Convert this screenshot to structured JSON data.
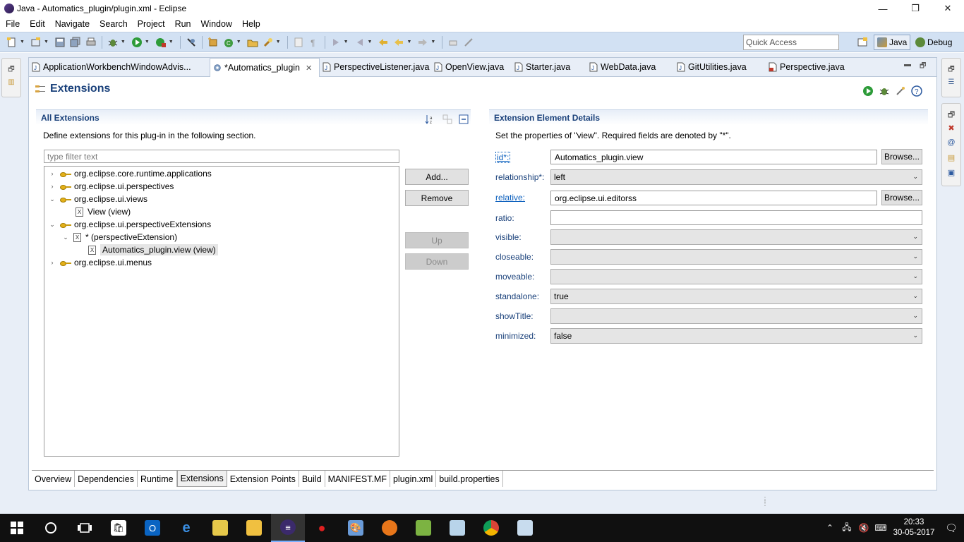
{
  "window": {
    "title": "Java - Automatics_plugin/plugin.xml - Eclipse",
    "minimize": "—",
    "restore": "❐",
    "close": "✕"
  },
  "menu": [
    "File",
    "Edit",
    "Navigate",
    "Search",
    "Project",
    "Run",
    "Window",
    "Help"
  ],
  "toolbar": {
    "quick_access_placeholder": "Quick Access",
    "perspectives": [
      "Java",
      "Debug"
    ]
  },
  "editor_tabs": [
    {
      "label": "ApplicationWorkbenchWindowAdvis...",
      "icon": "java-file-icon",
      "active": false
    },
    {
      "label": "*Automatics_plugin",
      "icon": "plugin-icon",
      "active": true,
      "close": "✕"
    },
    {
      "label": "PerspectiveListener.java",
      "icon": "java-file-icon",
      "active": false
    },
    {
      "label": "OpenView.java",
      "icon": "java-file-icon",
      "active": false
    },
    {
      "label": "Starter.java",
      "icon": "java-file-icon",
      "active": false
    },
    {
      "label": "WebData.java",
      "icon": "java-file-icon",
      "active": false
    },
    {
      "label": "GitUtilities.java",
      "icon": "java-file-icon",
      "active": false
    },
    {
      "label": "Perspective.java",
      "icon": "java-file-icon",
      "active": false
    }
  ],
  "form": {
    "title": "Extensions"
  },
  "all_extensions": {
    "title": "All Extensions",
    "description": "Define extensions for this plug-in in the following section.",
    "filter_placeholder": "type filter text",
    "tree": [
      {
        "label": "org.eclipse.core.runtime.applications",
        "level": 0,
        "type": "extension",
        "expanded": false
      },
      {
        "label": "org.eclipse.ui.perspectives",
        "level": 0,
        "type": "extension",
        "expanded": false
      },
      {
        "label": "org.eclipse.ui.views",
        "level": 0,
        "type": "extension",
        "expanded": true
      },
      {
        "label": "View (view)",
        "level": 1,
        "type": "element",
        "expanded": null
      },
      {
        "label": "org.eclipse.ui.perspectiveExtensions",
        "level": 0,
        "type": "extension",
        "expanded": true
      },
      {
        "label": "* (perspectiveExtension)",
        "level": 1,
        "type": "element",
        "expanded": true
      },
      {
        "label": "Automatics_plugin.view (view)",
        "level": 2,
        "type": "element",
        "expanded": null,
        "selected": true
      },
      {
        "label": "org.eclipse.ui.menus",
        "level": 0,
        "type": "extension",
        "expanded": false
      }
    ],
    "buttons": {
      "add": "Add...",
      "remove": "Remove",
      "up": "Up",
      "down": "Down"
    }
  },
  "details": {
    "title": "Extension Element Details",
    "description": "Set the properties of \"view\". Required fields are denoted by \"*\".",
    "browse": "Browse...",
    "fields": {
      "id_label": "id*:",
      "id_value": "Automatics_plugin.view",
      "relationship_label": "relationship*:",
      "relationship_value": "left",
      "relative_label": "relative:",
      "relative_value": "org.eclipse.ui.editorss",
      "ratio_label": "ratio:",
      "ratio_value": "",
      "visible_label": "visible:",
      "visible_value": "",
      "closeable_label": "closeable:",
      "closeable_value": "",
      "moveable_label": "moveable:",
      "moveable_value": "",
      "standalone_label": "standalone:",
      "standalone_value": "true",
      "showtitle_label": "showTitle:",
      "showtitle_value": "",
      "minimized_label": "minimized:",
      "minimized_value": "false"
    }
  },
  "page_tabs": [
    "Overview",
    "Dependencies",
    "Runtime",
    "Extensions",
    "Extension Points",
    "Build",
    "MANIFEST.MF",
    "plugin.xml",
    "build.properties"
  ],
  "active_page_tab": "Extensions",
  "taskbar": {
    "time": "20:33",
    "date": "30-05-2017"
  }
}
